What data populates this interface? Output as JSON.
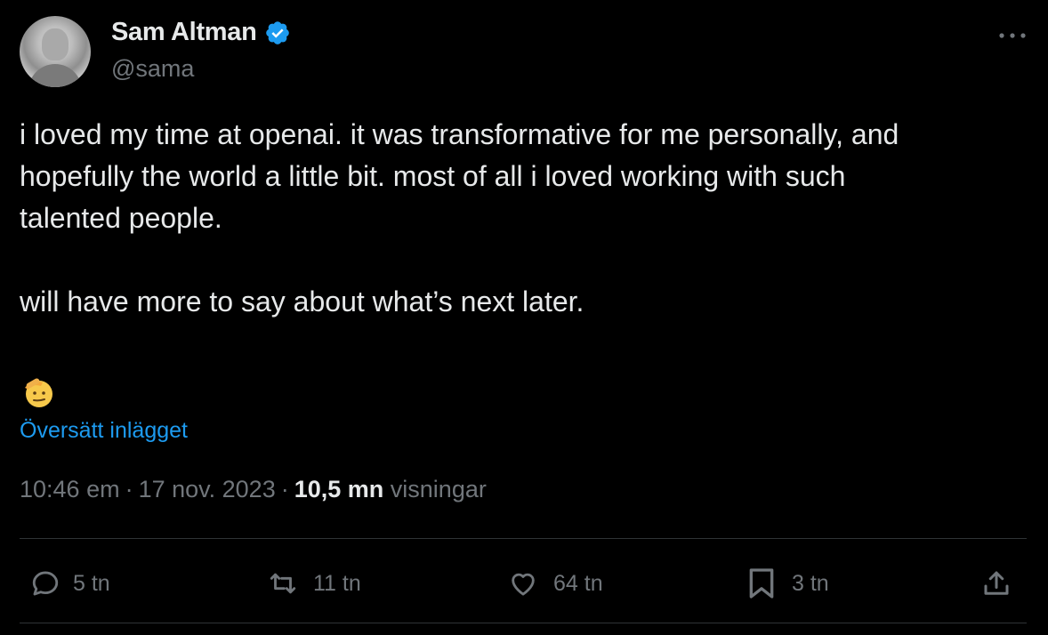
{
  "author": {
    "display_name": "Sam Altman",
    "handle": "@sama",
    "verified": true
  },
  "tweet": {
    "text": "i loved my time at openai. it was transformative for me personally, and\nhopefully the world a little bit. most of all i loved working with such\ntalented people.\n\nwill have more to say about what’s next later.",
    "emoji": "saluting-face",
    "translate_label": "Översätt inlägget"
  },
  "meta": {
    "time": "10:46 em",
    "date": "17 nov. 2023",
    "views_count": "10,5 mn",
    "views_label": "visningar",
    "separator": "·"
  },
  "actions": {
    "replies": "5 tn",
    "reposts": "11 tn",
    "likes": "64 tn",
    "bookmarks": "3 tn"
  },
  "icons": {
    "verified": "verified-badge-icon",
    "more": "more-icon",
    "reply": "reply-icon",
    "repost": "repost-icon",
    "like": "heart-icon",
    "bookmark": "bookmark-icon",
    "share": "share-icon"
  },
  "colors": {
    "background": "#000000",
    "text": "#e7e9ea",
    "secondary": "#71767b",
    "link": "#1d9bf0",
    "verified": "#1d9bf0",
    "divider": "#2f3336"
  }
}
